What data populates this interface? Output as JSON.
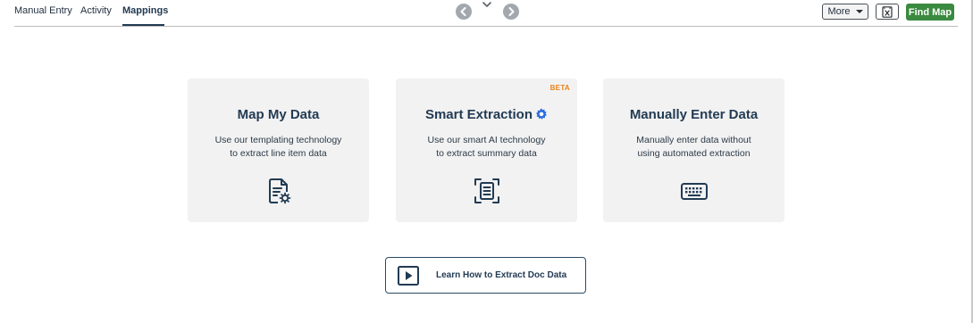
{
  "tabs": [
    {
      "label": "Manual Entry"
    },
    {
      "label": "Activity"
    },
    {
      "label": "Mappings"
    }
  ],
  "toolbar": {
    "more_label": "More",
    "find_map_label": "Find Map"
  },
  "cards": [
    {
      "title": "Map My Data",
      "desc_line1": "Use our templating technology",
      "desc_line2": "to extract line item data",
      "icon": "document-gear-icon"
    },
    {
      "title": "Smart Extraction",
      "badge": "BETA",
      "desc_line1": "Use our smart AI technology",
      "desc_line2": "to extract summary data",
      "icon": "document-scan-icon"
    },
    {
      "title": "Manually Enter Data",
      "desc_line1": "Manually enter data without",
      "desc_line2": "using automated extraction",
      "icon": "keyboard-icon"
    }
  ],
  "learn": {
    "label": "Learn How to Extract Doc Data",
    "icon": "play-icon"
  },
  "colors": {
    "accent": "#3a8a3f",
    "navy": "#223b53",
    "beta": "#e8821b",
    "card_bg": "#f2f2f2",
    "gear_blue": "#2d6cdf"
  }
}
